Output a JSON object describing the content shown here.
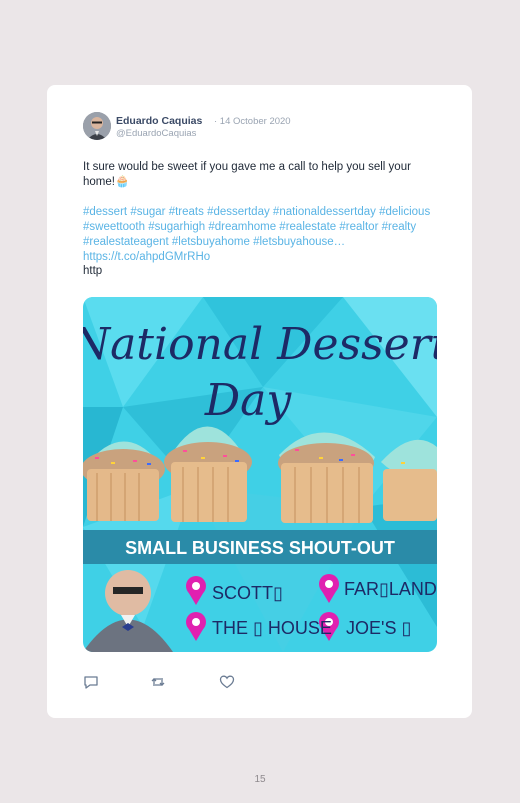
{
  "post": {
    "author_name": "Eduardo Caquias",
    "date": "· 14 October 2020",
    "handle": "@EduardoCaquias",
    "text": "It sure would be sweet if you gave me a call to help you sell your home!🧁",
    "hashtags": [
      "#dessert",
      "#sugar",
      "#treats",
      "#dessertday",
      "#nationaldessertday",
      "#delicious",
      "#sweettooth",
      "#sugarhigh",
      "#dreamhome",
      "#realestate",
      "#realtor",
      "#realty",
      "#realestateagent",
      "#letsbuyahome",
      "#letsbuyahouse…"
    ],
    "link": "https://t.co/ahpdGMrRHo",
    "trailing": "http"
  },
  "media": {
    "title_line1": "National Dessert",
    "title_line2": "Day",
    "banner": "SMALL BUSINESS SHOUT-OUT",
    "shoutouts": [
      "SCOTT▯",
      "FAR▯LAND",
      "THE ▯ HOUSE",
      "JOE'S ▯"
    ],
    "colors": {
      "background": "#3fd0e6",
      "title": "#1d2a66",
      "banner": "#2a8ba8",
      "pin": "#e020b0"
    }
  },
  "actions": {
    "reply_icon": "speech-bubble-icon",
    "retweet_icon": "retweet-icon",
    "like_icon": "heart-icon"
  },
  "page_number": "15"
}
